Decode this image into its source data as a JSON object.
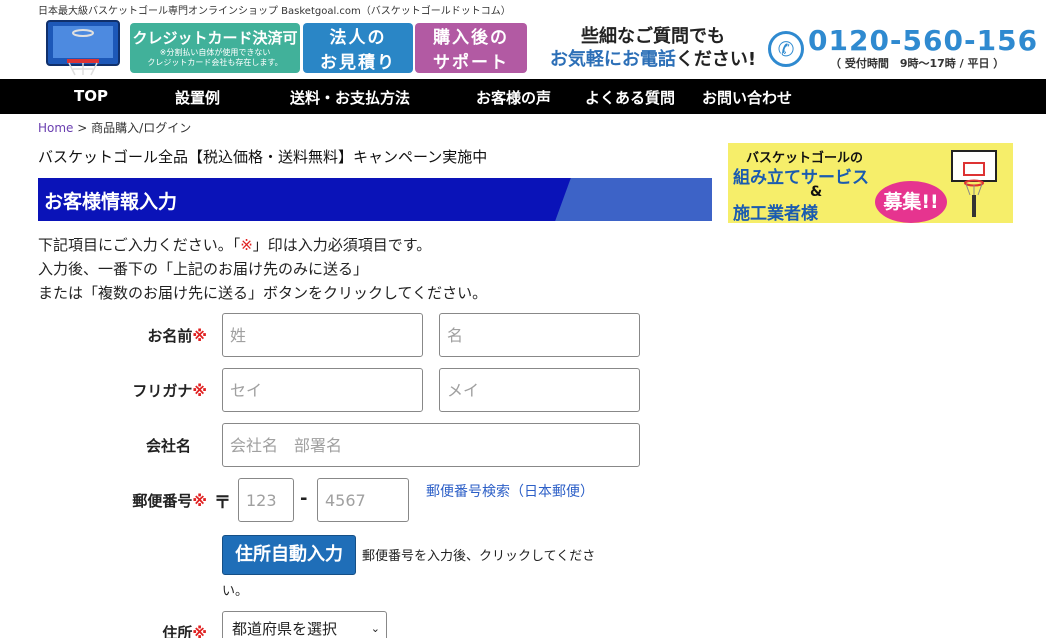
{
  "header": {
    "tagline": "日本最大級バスケットゴール専門オンラインショップ Basketgoal.com（バスケットゴールドットコム）",
    "banners": {
      "credit_title": "クレジットカード決済可",
      "credit_note1": "※分割払い自体が使用できない",
      "credit_note2": "クレジットカード会社も存在します。",
      "corp_line1": "法人の",
      "corp_line2": "お見積り",
      "support_line1": "購入後の",
      "support_line2": "サポート"
    },
    "contact": {
      "line1": "些細なご質問でも",
      "line2_blue": "お気軽にお電話",
      "line2_rest": "ください!",
      "phone": "0120-560-156",
      "hours": "（ 受付時間　9時～17時 / 平日 ）"
    }
  },
  "nav": {
    "items": [
      "TOP",
      "設置例",
      "送料・お支払方法",
      "お客様の声",
      "よくある質問",
      "お問い合わせ"
    ]
  },
  "breadcrumb": {
    "home": "Home",
    "sep": ">",
    "current": "商品購入/ログイン"
  },
  "campaign": "バスケットゴール全品【税込価格・送料無料】キャンペーン実施中",
  "section_title": "お客様情報入力",
  "intro": {
    "line1_a": "下記項目にご入力ください。「",
    "req_mark": "※",
    "line1_b": "」印は入力必須項目です。",
    "line2": "入力後、一番下の「上記のお届け先のみに送る」",
    "line3": "または「複数のお届け先に送る」ボタンをクリックしてください。"
  },
  "form": {
    "required_mark": "※",
    "name_label": "お名前",
    "last_name_placeholder": "姓",
    "first_name_placeholder": "名",
    "kana_label": "フリガナ",
    "last_kana_placeholder": "セイ",
    "first_kana_placeholder": "メイ",
    "company_label": "会社名",
    "company_placeholder": "会社名　部署名",
    "zip_label": "郵便番号",
    "zip_mark": "〒",
    "zip1_placeholder": "123",
    "zip_dash": "-",
    "zip2_placeholder": "4567",
    "zip_search_link": "郵便番号検索（日本郵便）",
    "auto_button": "住所自動入力",
    "auto_note_line1": "郵便番号を入力後、クリックしてくださ",
    "auto_note_line2": "い。",
    "address_label": "住所",
    "prefecture_selected": "都道府県を選択"
  },
  "side_ad": {
    "line1": "バスケットゴールの",
    "line2": "組み立てサービス",
    "line3": "&",
    "line4": "施工業者様",
    "burst": "募集!!"
  },
  "colors": {
    "nav_bg": "#000000",
    "section_bg": "#0a13b8",
    "required": "#e02020",
    "phone": "#2f8ad0",
    "button": "#1f6eb8"
  }
}
